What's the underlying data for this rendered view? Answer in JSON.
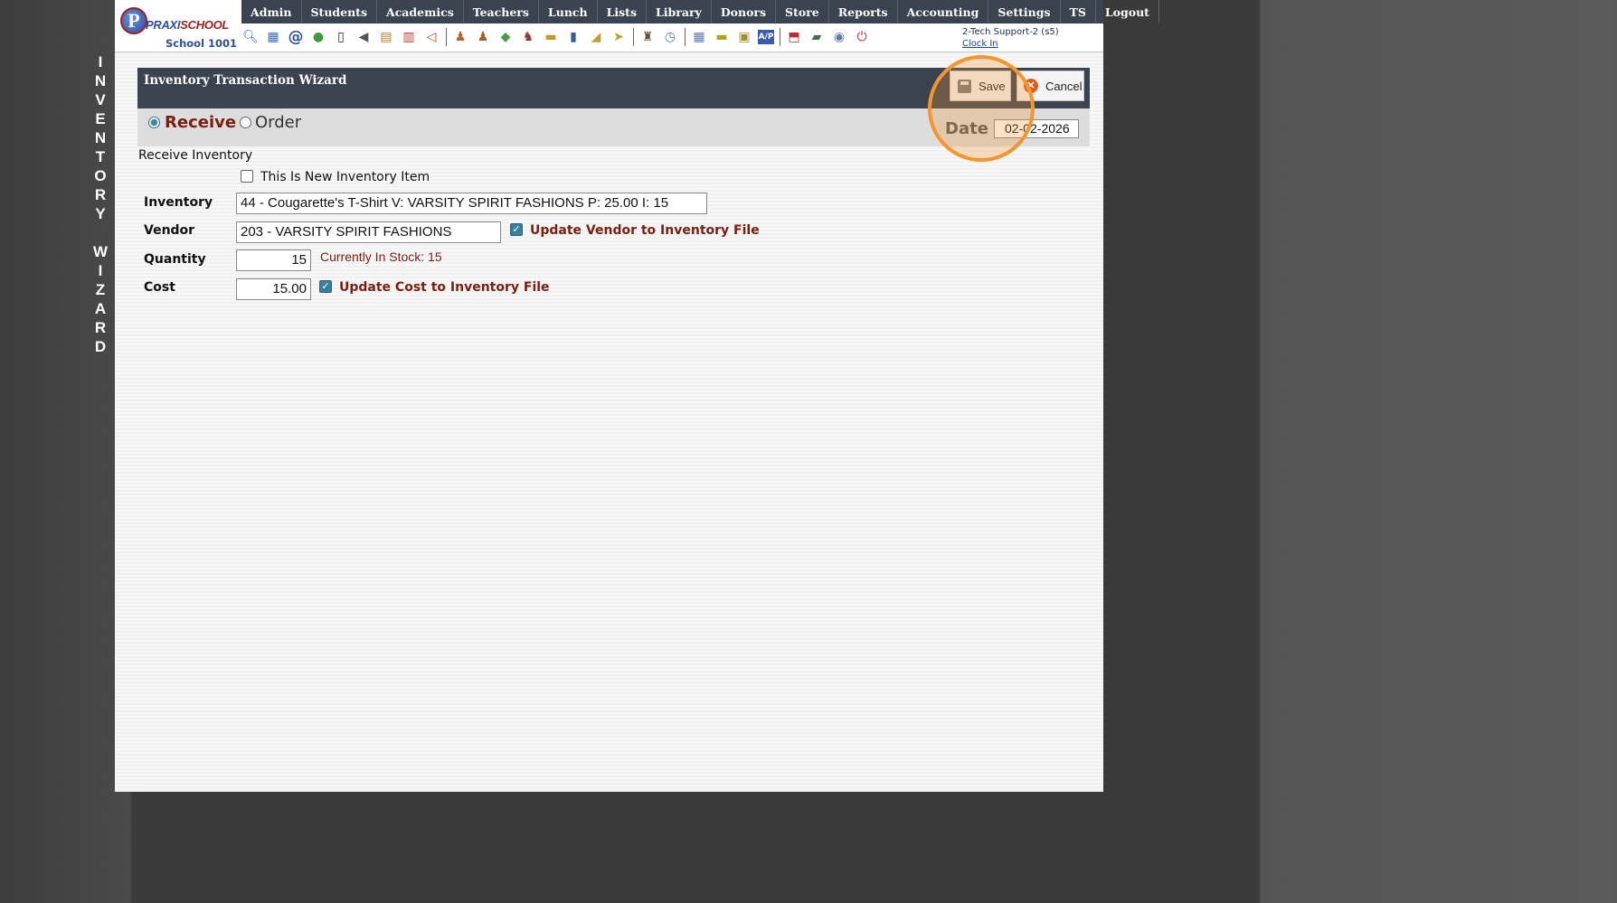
{
  "side_title": "I\nN\nV\nE\nN\nT\nO\nR\nY\n \nW\nI\nZ\nA\nR\nD",
  "logo": {
    "mark": "P",
    "brand_a": "PRAXI",
    "brand_b": "SCHOOL",
    "school": "School 1001"
  },
  "nav": [
    "Admin",
    "Students",
    "Academics",
    "Teachers",
    "Lunch",
    "Lists",
    "Library",
    "Donors",
    "Store",
    "Reports",
    "Accounting",
    "Settings",
    "TS",
    "Logout"
  ],
  "toolbar_icons": [
    "search-icon",
    "calendar-grid-icon",
    "at-sign-icon",
    "chat-icon",
    "phone-icon",
    "speaker-icon",
    "form-icon",
    "calendar-icon",
    "megaphone-icon",
    "person-icon",
    "person-alt-icon",
    "money-icon",
    "group-icon",
    "lunch-icon",
    "book-icon",
    "broom-icon",
    "export-icon",
    "teacher-icon",
    "clock-icon",
    "table-icon",
    "card-icon",
    "printer-icon",
    "ap-icon",
    "pdf-icon",
    "cash-icon",
    "help-icon",
    "power-icon"
  ],
  "user": {
    "name": "2-Tech Support-2 (s5)",
    "clock_link": "Clock In"
  },
  "wizard": {
    "title": "Inventory Transaction Wizard",
    "save_label": "Save",
    "cancel_label": "Cancel",
    "mode_receive": "Receive",
    "mode_order": "Order",
    "selected_mode": "Receive",
    "date_label": "Date",
    "date_value": "02-02-2026"
  },
  "form": {
    "section_title": "Receive Inventory",
    "new_item_label": "This Is New Inventory Item",
    "new_item_checked": false,
    "inventory_label": "Inventory",
    "inventory_value": "44 - Cougarette's T-Shirt V: VARSITY SPIRIT FASHIONS P: 25.00 I: 15",
    "vendor_label": "Vendor",
    "vendor_value": "203 - VARSITY SPIRIT FASHIONS",
    "update_vendor_label": "Update Vendor to Inventory File",
    "update_vendor_checked": true,
    "quantity_label": "Quantity",
    "quantity_value": "15",
    "stock_text": "Currently In Stock: 15",
    "cost_label": "Cost",
    "cost_value": "15.00",
    "update_cost_label": "Update Cost to Inventory File",
    "update_cost_checked": true
  },
  "colors": {
    "nav_bg": "#3b4250",
    "accent_red": "#7a1f10",
    "highlight": "#f29632"
  }
}
